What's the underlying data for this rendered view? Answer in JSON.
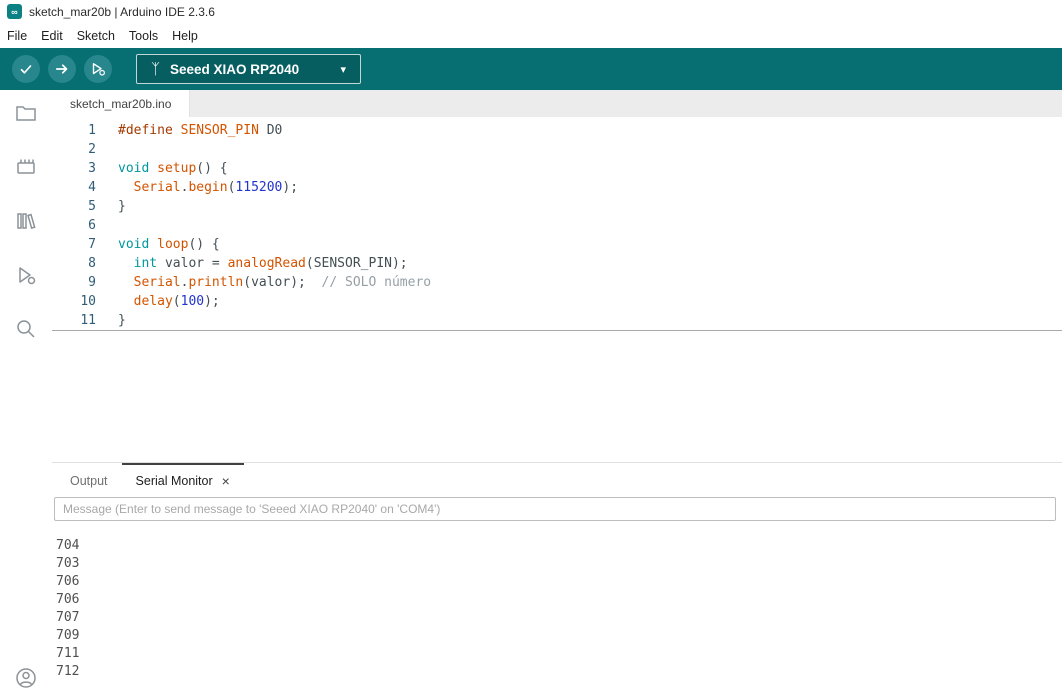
{
  "window": {
    "title": "sketch_mar20b | Arduino IDE 2.3.6"
  },
  "menu": {
    "items": [
      "File",
      "Edit",
      "Sketch",
      "Tools",
      "Help"
    ]
  },
  "toolbar": {
    "board_label": "Seeed XIAO RP2040"
  },
  "icons": {
    "app_logo": "∞",
    "usb": "ᛉ",
    "caret": "▾",
    "close": "×"
  },
  "sidebar": {
    "items": [
      "sketchbook",
      "boards-manager",
      "library-manager",
      "debug",
      "search"
    ],
    "bottom": "account"
  },
  "editor_tabs": [
    {
      "label": "sketch_mar20b.ino"
    }
  ],
  "editor": {
    "lines": [
      {
        "num": "1",
        "s": [
          [
            "pp",
            "#define"
          ],
          [
            "p",
            " "
          ],
          [
            "f",
            "SENSOR_PIN"
          ],
          [
            "p",
            " D0"
          ]
        ]
      },
      {
        "num": "2",
        "s": []
      },
      {
        "num": "3",
        "s": [
          [
            "k",
            "void"
          ],
          [
            "p",
            " "
          ],
          [
            "f",
            "setup"
          ],
          [
            "p",
            "() {"
          ]
        ]
      },
      {
        "num": "4",
        "s": [
          [
            "p",
            "  "
          ],
          [
            "f",
            "Serial"
          ],
          [
            "p",
            "."
          ],
          [
            "f",
            "begin"
          ],
          [
            "p",
            "("
          ],
          [
            "n",
            "115200"
          ],
          [
            "p",
            ");"
          ]
        ]
      },
      {
        "num": "5",
        "s": [
          [
            "p",
            "}"
          ]
        ]
      },
      {
        "num": "6",
        "s": []
      },
      {
        "num": "7",
        "s": [
          [
            "k",
            "void"
          ],
          [
            "p",
            " "
          ],
          [
            "f",
            "loop"
          ],
          [
            "p",
            "() {"
          ]
        ]
      },
      {
        "num": "8",
        "s": [
          [
            "p",
            "  "
          ],
          [
            "k",
            "int"
          ],
          [
            "p",
            " valor = "
          ],
          [
            "f",
            "analogRead"
          ],
          [
            "p",
            "(SENSOR_PIN);"
          ]
        ]
      },
      {
        "num": "9",
        "s": [
          [
            "p",
            "  "
          ],
          [
            "f",
            "Serial"
          ],
          [
            "p",
            "."
          ],
          [
            "f",
            "println"
          ],
          [
            "p",
            "(valor);"
          ],
          [
            "c",
            "  // SOLO número"
          ]
        ]
      },
      {
        "num": "10",
        "s": [
          [
            "p",
            "  "
          ],
          [
            "f",
            "delay"
          ],
          [
            "p",
            "("
          ],
          [
            "n",
            "100"
          ],
          [
            "p",
            ");"
          ]
        ]
      },
      {
        "num": "11",
        "s": [
          [
            "p",
            "}"
          ]
        ],
        "active": true
      }
    ]
  },
  "bottom": {
    "tabs": [
      {
        "label": "Output"
      },
      {
        "label": "Serial Monitor"
      }
    ],
    "active_tab": "Serial Monitor",
    "input_placeholder": "Message (Enter to send message to 'Seeed XIAO RP2040' on 'COM4')",
    "serial_lines": [
      "704",
      "703",
      "706",
      "706",
      "707",
      "709",
      "711",
      "712"
    ]
  },
  "colors": {
    "toolbar_teal": "#076e72",
    "accent": "#00979c",
    "active_tab_indicator": "#414141"
  }
}
